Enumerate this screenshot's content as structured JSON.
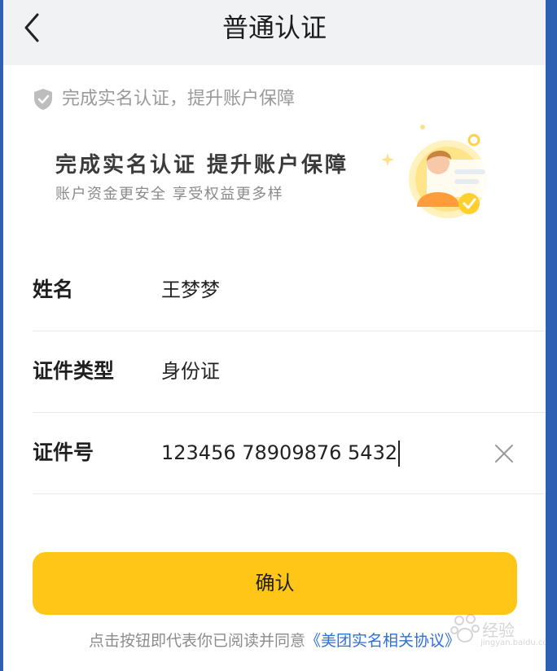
{
  "nav": {
    "title": "普通认证"
  },
  "tip": {
    "text": "完成实名认证，提升账户保障"
  },
  "banner": {
    "title": "完成实名认证 提升账户保障",
    "subtitle": "账户资金更安全 享受权益更多样"
  },
  "form": {
    "name": {
      "label": "姓名",
      "value": "王梦梦"
    },
    "id_type": {
      "label": "证件类型",
      "value": "身份证"
    },
    "id_number": {
      "label": "证件号",
      "value": "123456 78909876 5432"
    }
  },
  "confirm": {
    "label": "确认"
  },
  "agreement": {
    "text": "点击按钮即代表你已阅读并同意",
    "link": "《美团实名相关协议》"
  },
  "watermark": {
    "text": "经验",
    "sub": "jingyan.baidu.com"
  },
  "colors": {
    "accent": "#ffc618",
    "link": "#2f6fd8",
    "frame": "#2d5fb3"
  }
}
